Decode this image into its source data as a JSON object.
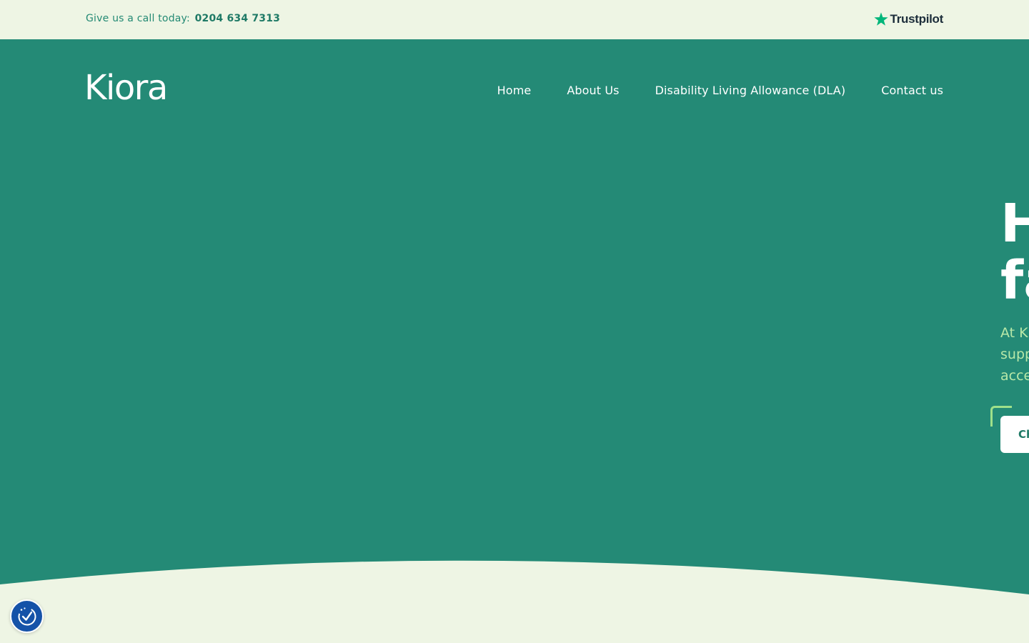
{
  "topbar": {
    "call_label": "Give us a call today:",
    "phone": "0204 634 7313",
    "trustpilot_label": "Trustpilot"
  },
  "brand": {
    "logo_text": "Kiora"
  },
  "nav": {
    "items": [
      {
        "label": "Home"
      },
      {
        "label": "About Us"
      },
      {
        "label": "Disability Living Allowance (DLA)"
      },
      {
        "label": "Contact us"
      }
    ]
  },
  "hero": {
    "headline_line1": "H",
    "headline_line2": "fa",
    "subtext_line1": "At K",
    "subtext_line2": "supp",
    "subtext_line3": "acce",
    "cta_label": "Ch"
  },
  "colors": {
    "hero_bg": "#248a76",
    "cream_bg": "#eef5e4",
    "accent_green": "#9fe08a",
    "accessibility_blue": "#1552a8",
    "trustpilot_green": "#00b67a"
  },
  "icons": {
    "trustpilot_star": "trustpilot-star-icon",
    "accessibility": "accessibility-icon"
  }
}
